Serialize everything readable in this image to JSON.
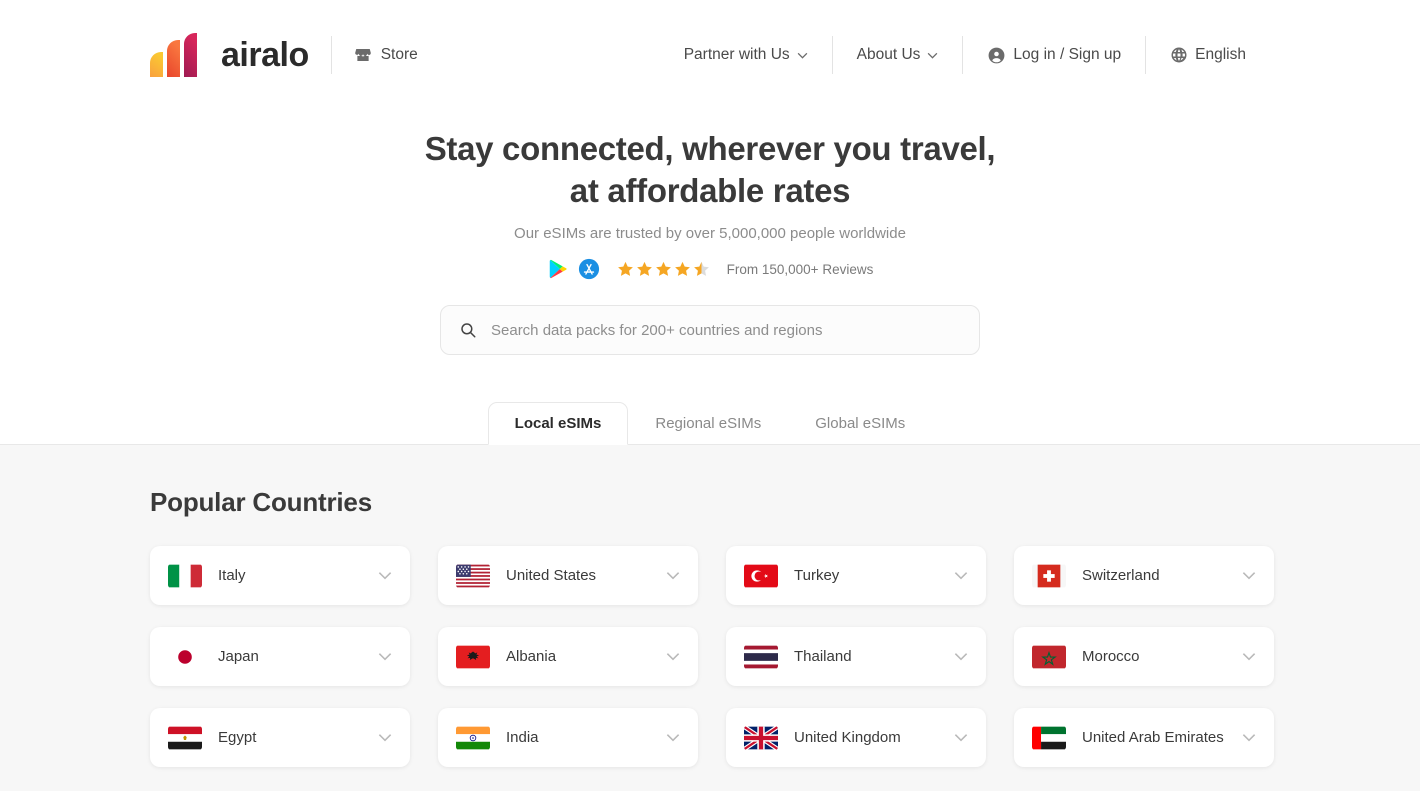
{
  "header": {
    "logo_text": "airalo",
    "store_label": "Store",
    "store_icon": "store-icon",
    "nav": [
      {
        "label": "Partner with Us",
        "icon": "chevron-down-icon",
        "name": "partner-with-us"
      },
      {
        "label": "About Us",
        "icon": "chevron-down-icon",
        "name": "about-us"
      },
      {
        "label": "Log in / Sign up",
        "icon": "user-circle-icon",
        "name": "login-signup"
      },
      {
        "label": "English",
        "icon": "globe-icon",
        "name": "language"
      }
    ]
  },
  "hero": {
    "title_line1": "Stay connected, wherever you travel,",
    "title_line2": "at affordable rates",
    "subtitle": "Our eSIMs are trusted by over 5,000,000 people worldwide",
    "rating": {
      "google_play_icon": "google-play-icon",
      "app_store_icon": "app-store-icon",
      "stars_filled": 4,
      "stars_half": 1,
      "stars_total": 5,
      "star_color": "#F5A623",
      "reviews_text": "From 150,000+ Reviews"
    }
  },
  "search": {
    "icon": "search-icon",
    "placeholder": "Search data packs for 200+ countries and regions",
    "value": ""
  },
  "tabs": {
    "active_index": 0,
    "items": [
      {
        "label": "Local eSIMs"
      },
      {
        "label": "Regional eSIMs"
      },
      {
        "label": "Global eSIMs"
      }
    ]
  },
  "popular": {
    "heading": "Popular Countries",
    "chevron_icon": "chevron-down-icon",
    "countries": [
      {
        "name": "Italy",
        "flag": "it"
      },
      {
        "name": "United States",
        "flag": "us"
      },
      {
        "name": "Turkey",
        "flag": "tr"
      },
      {
        "name": "Switzerland",
        "flag": "ch"
      },
      {
        "name": "Japan",
        "flag": "jp"
      },
      {
        "name": "Albania",
        "flag": "al"
      },
      {
        "name": "Thailand",
        "flag": "th"
      },
      {
        "name": "Morocco",
        "flag": "ma"
      },
      {
        "name": "Egypt",
        "flag": "eg"
      },
      {
        "name": "India",
        "flag": "in"
      },
      {
        "name": "United Kingdom",
        "flag": "gb"
      },
      {
        "name": "United Arab Emirates",
        "flag": "ae"
      }
    ]
  }
}
